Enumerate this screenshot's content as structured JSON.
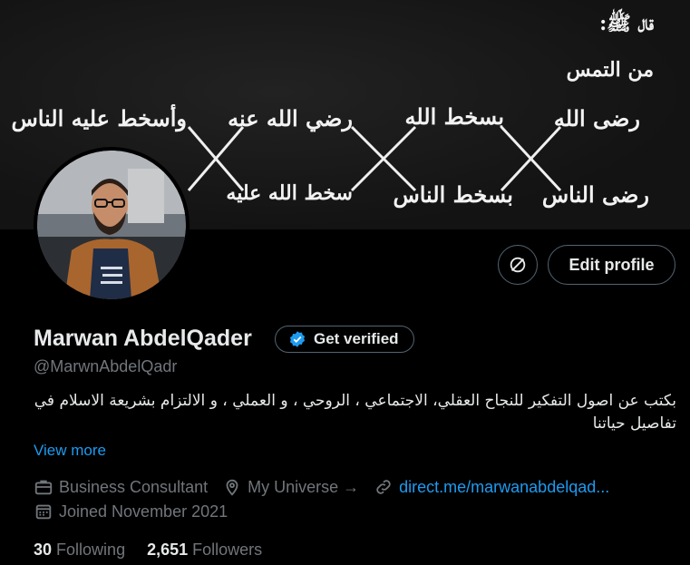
{
  "banner": {
    "header_line1": "قال ﷺ:",
    "header_line2": "من التمس",
    "top_row": [
      "رضى الله",
      "بسخط الله",
      "رضي الله عنه",
      "وأسخط عليه الناس"
    ],
    "bottom_row": [
      "رضى الناس",
      "بسخط الناس",
      "سخط الله عليه"
    ]
  },
  "actions": {
    "edit_profile": "Edit profile"
  },
  "profile": {
    "name": "Marwan AbdelQader",
    "verify_label": "Get verified",
    "handle": "@MarwnAbdelQadr",
    "bio": "بكتب عن اصول التفكير للنجاح العقلي، الاجتماعي ، الروحي ، و العملي ، و الالتزام بشريعة الاسلام في تفاصيل حياتنا",
    "view_more": "View more",
    "category": "Business Consultant",
    "location": "My Universe →",
    "website": "direct.me/marwanabdelqad...",
    "joined": "Joined November 2021"
  },
  "stats": {
    "following_count": "30",
    "following_label": "Following",
    "followers_count": "2,651",
    "followers_label": "Followers"
  },
  "colors": {
    "accent": "#1d9bf0",
    "muted": "#71767b",
    "border": "#536471",
    "text": "#e7e9ea"
  }
}
